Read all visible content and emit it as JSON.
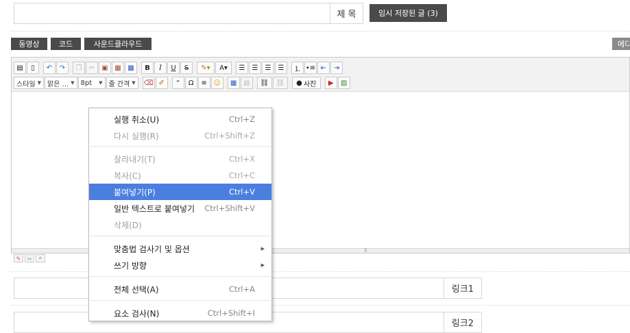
{
  "form": {
    "title_label": "제 목",
    "drafts_button": "임시 저장된 글 (3)",
    "link1_label": "링크1",
    "link2_label": "링크2"
  },
  "media_buttons": [
    "동영상",
    "코드",
    "사운드클라우드"
  ],
  "right_button": "에디",
  "toolbar": {
    "style_drop": "스타일",
    "font_drop": "맑은 ...",
    "size_drop": "8pt",
    "lineheight_drop": "줄 간격",
    "photo_button": "사진",
    "bold": "B",
    "italic": "I",
    "underline": "U",
    "strike": "S",
    "quote": "“",
    "omega": "Ω"
  },
  "context_menu": {
    "items": [
      {
        "label": "실행 취소(U)",
        "shortcut": "Ctrl+Z",
        "state": "normal"
      },
      {
        "label": "다시 실행(R)",
        "shortcut": "Ctrl+Shift+Z",
        "state": "disabled"
      },
      {
        "label": "잘라내기(T)",
        "shortcut": "Ctrl+X",
        "state": "disabled"
      },
      {
        "label": "복사(C)",
        "shortcut": "Ctrl+C",
        "state": "disabled"
      },
      {
        "label": "붙여넣기(P)",
        "shortcut": "Ctrl+V",
        "state": "active"
      },
      {
        "label": "일반 텍스트로 붙여넣기",
        "shortcut": "Ctrl+Shift+V",
        "state": "normal"
      },
      {
        "label": "삭제(D)",
        "shortcut": "",
        "state": "disabled"
      },
      {
        "label": "맞춤법 검사기 및 옵션",
        "shortcut": "",
        "state": "normal"
      },
      {
        "label": "쓰기 방향",
        "shortcut": "",
        "state": "normal"
      },
      {
        "label": "전체 선택(A)",
        "shortcut": "Ctrl+A",
        "state": "normal"
      },
      {
        "label": "요소 검사(N)",
        "shortcut": "Ctrl+Shift+I",
        "state": "normal"
      }
    ]
  }
}
